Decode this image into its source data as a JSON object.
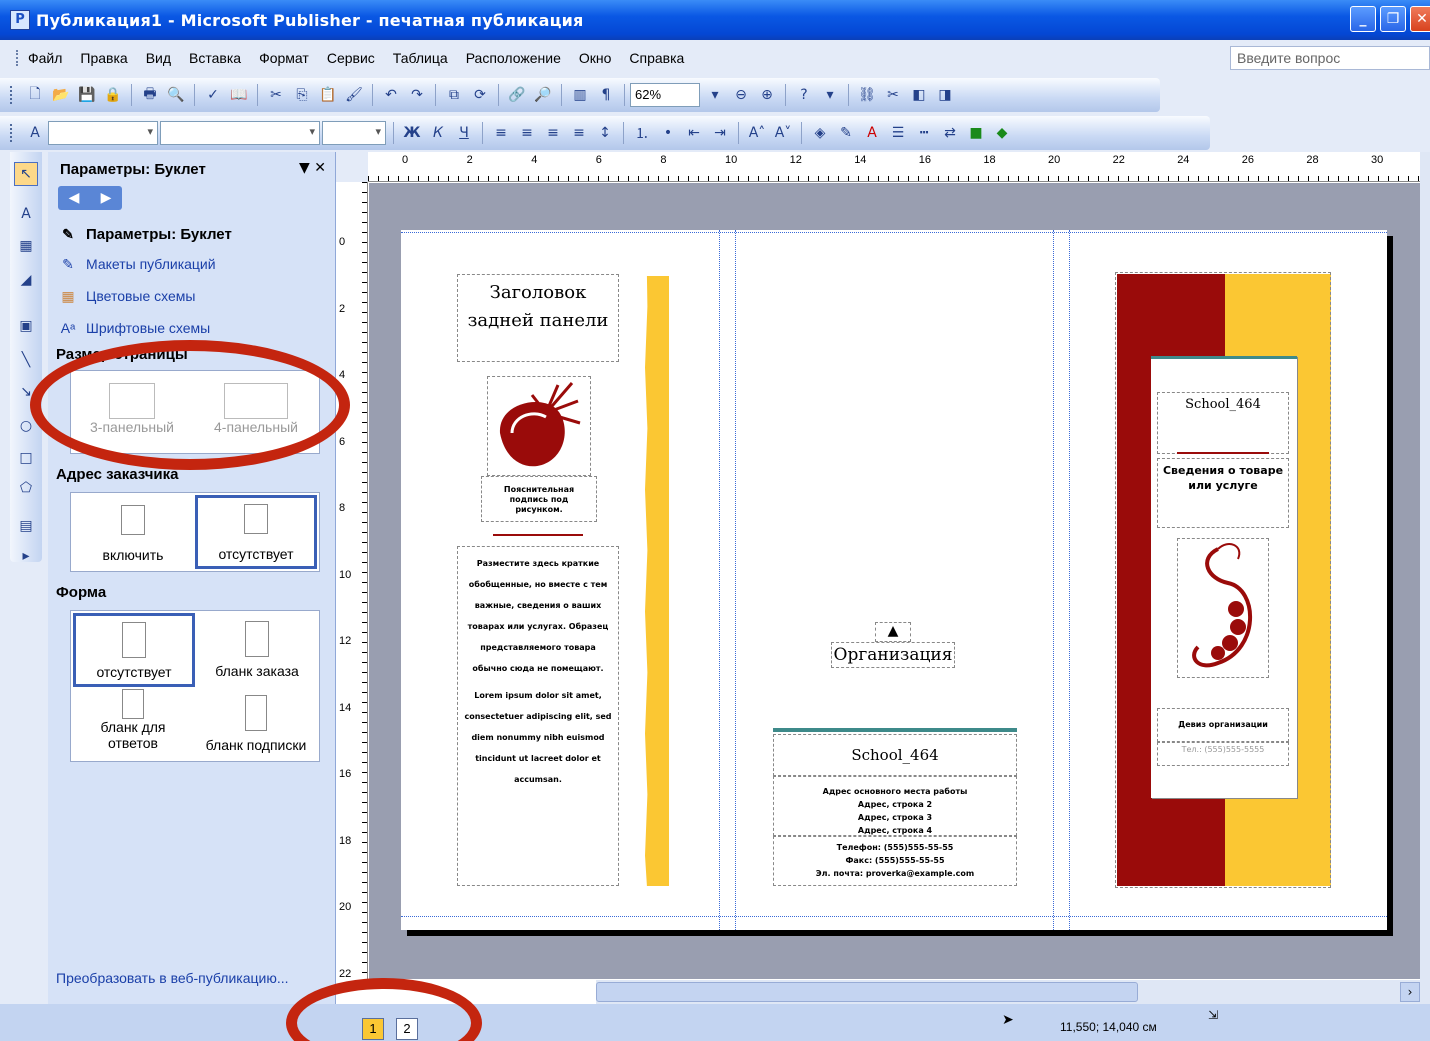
{
  "window": {
    "title": "Публикация1 - Microsoft Publisher - печатная публикация",
    "app_icon": "publisher-icon"
  },
  "menu": {
    "items": [
      "Файл",
      "Правка",
      "Вид",
      "Вставка",
      "Формат",
      "Сервис",
      "Таблица",
      "Расположение",
      "Окно",
      "Справка"
    ],
    "help_placeholder": "Введите вопрос"
  },
  "toolbar": {
    "zoom": "62%",
    "format_combo_1": "",
    "format_combo_2": "",
    "format_combo_3": ""
  },
  "task_pane": {
    "title": "Параметры: Буклет",
    "links": [
      {
        "label": "Параметры: Буклет",
        "icon": "options-icon"
      },
      {
        "label": "Макеты публикаций",
        "icon": "layouts-icon"
      },
      {
        "label": "Цветовые схемы",
        "icon": "color-schemes-icon"
      },
      {
        "label": "Шрифтовые схемы",
        "icon": "font-schemes-icon"
      }
    ],
    "page_size_label": "Размер страницы",
    "page_size_options": [
      "3-панельный",
      "4-панельный"
    ],
    "address_label": "Адрес заказчика",
    "address_options": [
      "включить",
      "отсутствует"
    ],
    "form_label": "Форма",
    "form_options": [
      "отсутствует",
      "бланк заказа",
      "бланк для ответов",
      "бланк подписки"
    ],
    "convert_link": "Преобразовать в веб-публикацию..."
  },
  "ruler": {
    "h_marks": [
      "0",
      "2",
      "4",
      "6",
      "8",
      "10",
      "12",
      "14",
      "16",
      "18",
      "20",
      "22",
      "24",
      "26",
      "28",
      "30"
    ],
    "v_marks": [
      "0",
      "2",
      "4",
      "6",
      "8",
      "10",
      "12",
      "14",
      "16",
      "18",
      "20",
      "22"
    ]
  },
  "brochure": {
    "back_title": "Заголовок задней панели",
    "caption": "Пояснительная подпись под рисунком.",
    "body_text": "Разместите здесь краткие обобщенные, но вместе с тем важные, сведения о ваших товарах или услугах. Образец представляемого товара обычно сюда не помещают.",
    "lorem": "Lorem ipsum dolor sit amet, consectetuer adipiscing elit, sed diem nonummy nibh euismod tincidunt ut lacreet dolor et accumsan.",
    "org_label": "Организация",
    "org_name": "School_464",
    "address_lines": [
      "Адрес основного места работы",
      "Адрес, строка 2",
      "Адрес, строка 3",
      "Адрес, строка 4"
    ],
    "phone": "Телефон: (555)555-55-55",
    "fax": "Факс: (555)555-55-55",
    "email": "Эл. почта: proverka@example.com",
    "cover_name": "School_464",
    "cover_title": "Сведения о товаре или услуге",
    "motto": "Девиз организации",
    "cover_phone": "Тел.: (555)555-5555",
    "colors": {
      "dark_red": "#9a0b0a",
      "yellow": "#fbc733",
      "accent_teal": "#3e8a8a"
    }
  },
  "status": {
    "pages": [
      "1",
      "2"
    ],
    "coords": "11,550; 14,040 см"
  }
}
